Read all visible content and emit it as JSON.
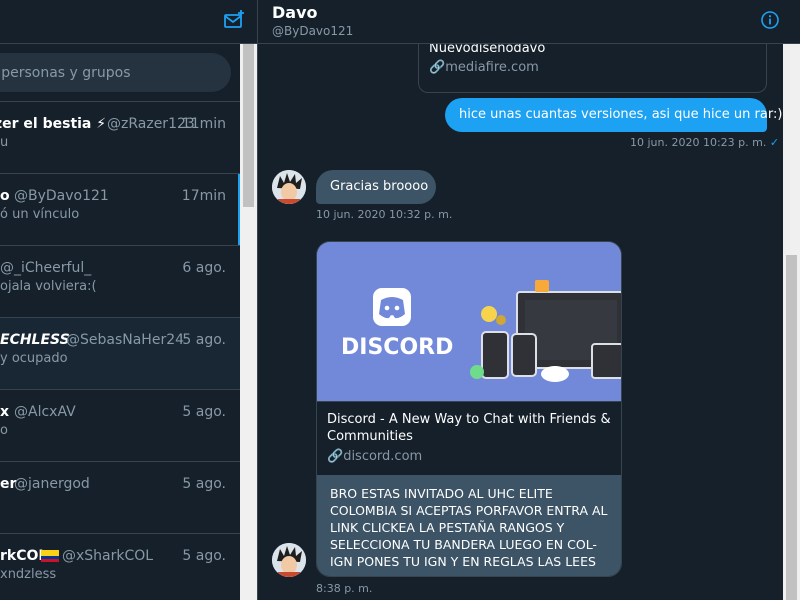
{
  "left": {
    "search_placeholder": "r personas y grupos",
    "conversations": [
      {
        "name": "zer el bestia ⚡",
        "handle": "@zRazer123",
        "time": "11min",
        "preview": "u"
      },
      {
        "name": "o",
        "handle": "@ByDavo121",
        "time": "17min",
        "preview": "ó un vínculo"
      },
      {
        "name": "",
        "handle": "@_iCheerful_",
        "time": "6 ago.",
        "preview": " ojala volviera:("
      },
      {
        "name": "ECHLESS",
        "handle": "@SebasNaHer24",
        "time": "5 ago.",
        "preview": "y ocupado"
      },
      {
        "name": "x",
        "handle": "@AlcxAV",
        "time": "5 ago.",
        "preview": "o"
      },
      {
        "name": "er",
        "handle": "@janergod",
        "time": "5 ago.",
        "preview": ""
      },
      {
        "name": "rkCOL",
        "handle": "@xSharkCOL",
        "time": "5 ago.",
        "preview": "xndzless"
      }
    ]
  },
  "chat": {
    "name": "Davo",
    "handle": "@ByDavo121",
    "link_top": {
      "title": "Nuevodiseñodavo",
      "domain": "mediafire.com"
    },
    "outgoing": {
      "text": "hice unas cuantas versiones, asi que hice un rar:)",
      "time": "10 jun. 2020 10:23 p. m.",
      "status": "✓"
    },
    "incoming": {
      "text": "Gracias broooo",
      "time": "10 jun. 2020 10:32 p. m."
    },
    "discord_card": {
      "logo_text": "DISCORD",
      "title": "Discord - A New Way to Chat with Friends & Communities",
      "domain": "discord.com",
      "message": "BRO ESTAS INVITADO AL UHC ELITE COLOMBIA SI ACEPTAS PORFAVOR ENTRA AL LINK CLICKEA LA PESTAÑA RANGOS Y SELECCIONA TU BANDERA LUEGO EN COL-IGN PONES TU IGN Y EN REGLAS LAS LEES",
      "time": "8:38 p. m."
    }
  },
  "colors": {
    "accent": "#1da1f2",
    "background": "#15202b",
    "bubble_in": "#3d5466",
    "discord": "#7289da"
  }
}
